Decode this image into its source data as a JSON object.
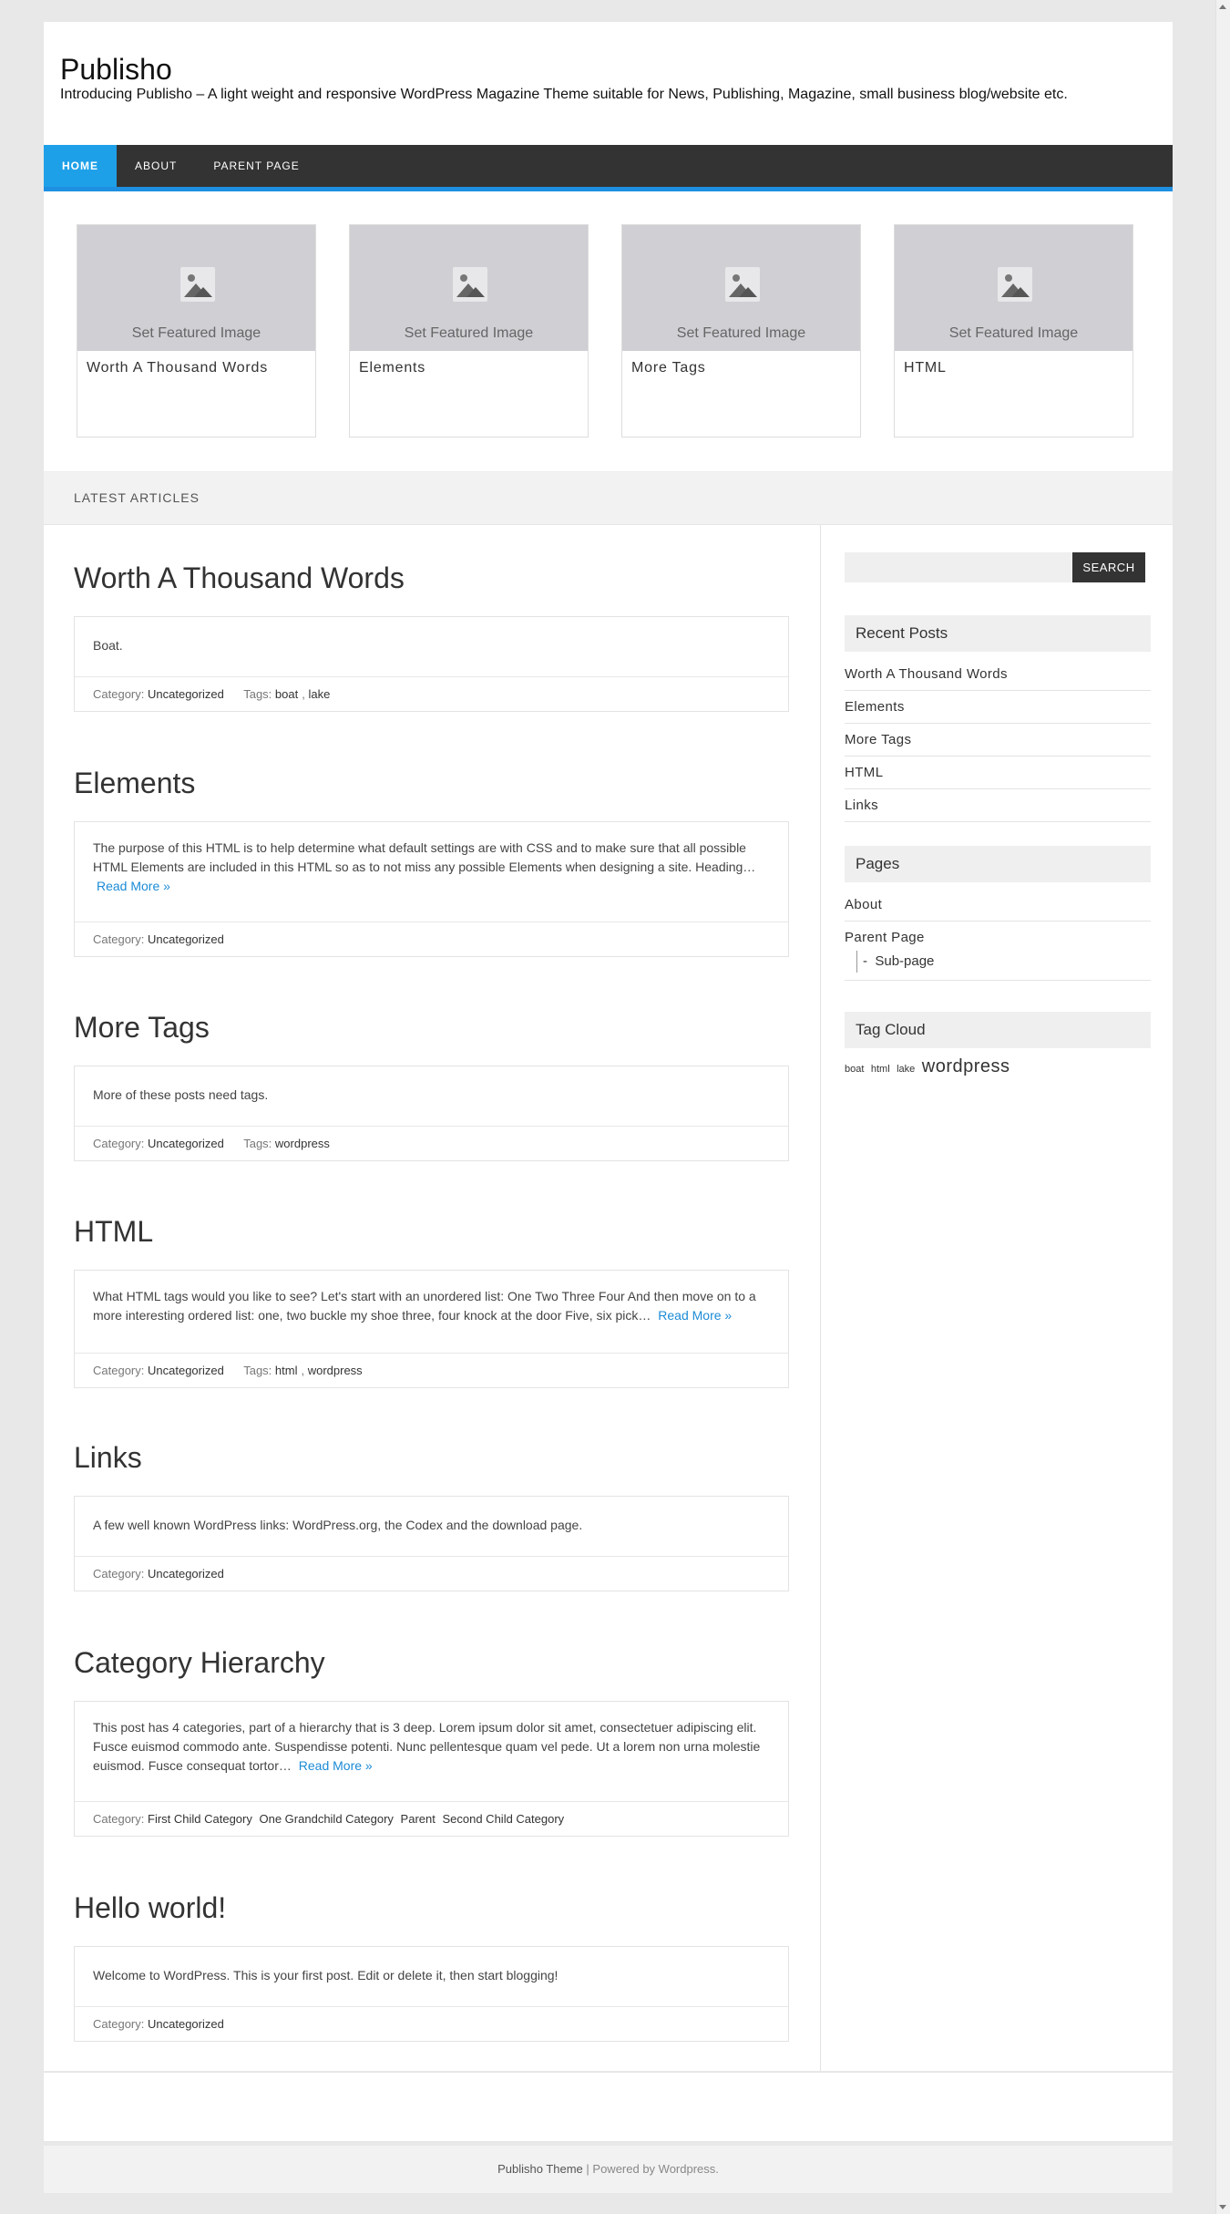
{
  "site": {
    "title": "Publisho",
    "description": "Introducing Publisho – A light weight and responsive WordPress Magazine Theme suitable for News, Publishing, Magazine, small business blog/website etc."
  },
  "nav": {
    "items": [
      {
        "label": "HOME",
        "active": true
      },
      {
        "label": "ABOUT"
      },
      {
        "label": "PARENT PAGE"
      }
    ]
  },
  "featured": {
    "placeholder_text": "Set Featured Image",
    "cards": [
      {
        "title": "Worth A Thousand Words"
      },
      {
        "title": "Elements"
      },
      {
        "title": "More Tags"
      },
      {
        "title": "HTML"
      }
    ]
  },
  "latest": {
    "label": "LATEST ARTICLES"
  },
  "meta_labels": {
    "category": "Category:",
    "tags": "Tags:"
  },
  "posts": [
    {
      "title": "Worth A Thousand Words",
      "excerpt": "Boat.",
      "read_more": "",
      "categories": [
        "Uncategorized"
      ],
      "tags": [
        "boat",
        "lake"
      ]
    },
    {
      "title": "Elements",
      "excerpt": "The purpose of this HTML is to help determine what default settings are with CSS and to make sure that all possible HTML Elements are included in this HTML so as to not miss any possible Elements when designing a site. Heading…",
      "read_more": "Read More »",
      "categories": [
        "Uncategorized"
      ],
      "tags": []
    },
    {
      "title": "More Tags",
      "excerpt": "More of these posts need tags.",
      "read_more": "",
      "categories": [
        "Uncategorized"
      ],
      "tags": [
        "wordpress"
      ]
    },
    {
      "title": "HTML",
      "excerpt": "What HTML tags would you like to see? Let's start with an unordered list: One Two Three Four And then move on to a more interesting ordered list: one, two buckle my shoe three, four knock at the door Five, six pick…",
      "read_more": "Read More »",
      "categories": [
        "Uncategorized"
      ],
      "tags": [
        "html",
        "wordpress"
      ]
    },
    {
      "title": "Links",
      "excerpt": "A few well known WordPress links: WordPress.org, the Codex and the download page.",
      "read_more": "",
      "categories": [
        "Uncategorized"
      ],
      "tags": []
    },
    {
      "title": "Category Hierarchy",
      "excerpt": "This post has 4 categories, part of a hierarchy that is 3 deep. Lorem ipsum dolor sit amet, consectetuer adipiscing elit. Fusce euismod commodo ante. Suspendisse potenti. Nunc pellentesque quam vel pede. Ut a lorem non urna molestie euismod. Fusce consequat tortor…",
      "read_more": "Read More »",
      "categories": [
        "First Child Category",
        "One Grandchild Category",
        "Parent",
        "Second Child Category"
      ],
      "tags": []
    },
    {
      "title": "Hello world!",
      "excerpt": "Welcome to WordPress. This is your first post. Edit or delete it, then start blogging!",
      "read_more": "",
      "categories": [
        "Uncategorized"
      ],
      "tags": []
    }
  ],
  "sidebar": {
    "search": {
      "placeholder": "",
      "button": "SEARCH"
    },
    "recent_posts": {
      "title": "Recent Posts",
      "items": [
        "Worth A Thousand Words",
        "Elements",
        "More Tags",
        "HTML",
        "Links"
      ]
    },
    "pages": {
      "title": "Pages",
      "items": [
        "About",
        "Parent Page"
      ],
      "subitem": "Sub-page",
      "sub_prefix": "-"
    },
    "tag_cloud": {
      "title": "Tag Cloud",
      "tags": [
        {
          "label": "boat",
          "weight": 1
        },
        {
          "label": "html",
          "weight": 1
        },
        {
          "label": "lake",
          "weight": 1
        },
        {
          "label": "wordpress",
          "weight": 2
        }
      ]
    }
  },
  "footer": {
    "theme": "Publisho Theme",
    "separator": " | ",
    "powered": "Powered by Wordpress."
  }
}
